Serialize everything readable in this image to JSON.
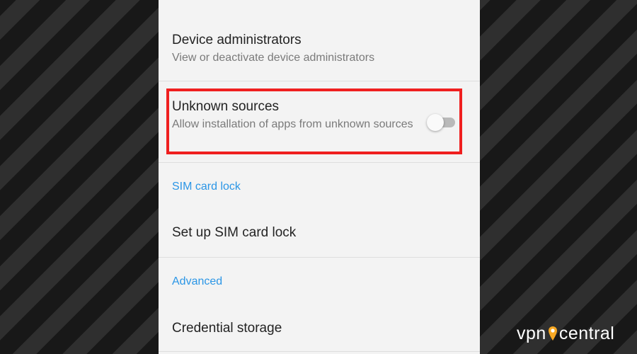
{
  "settings": {
    "device_admin": {
      "title": "Device administrators",
      "summary": "View or deactivate device administrators"
    },
    "unknown_sources": {
      "title": "Unknown sources",
      "summary": "Allow installation of apps from unknown sources",
      "enabled": false
    },
    "sim_section_header": "SIM card lock",
    "sim_lock_item": "Set up SIM card lock",
    "advanced_section_header": "Advanced",
    "credential_storage_item": "Credential storage"
  },
  "watermark": {
    "brand_left": "vpn",
    "brand_right": "central"
  },
  "colors": {
    "accent": "#2b96e6",
    "highlight": "#ef1f1f",
    "brand": "#f7a823"
  }
}
